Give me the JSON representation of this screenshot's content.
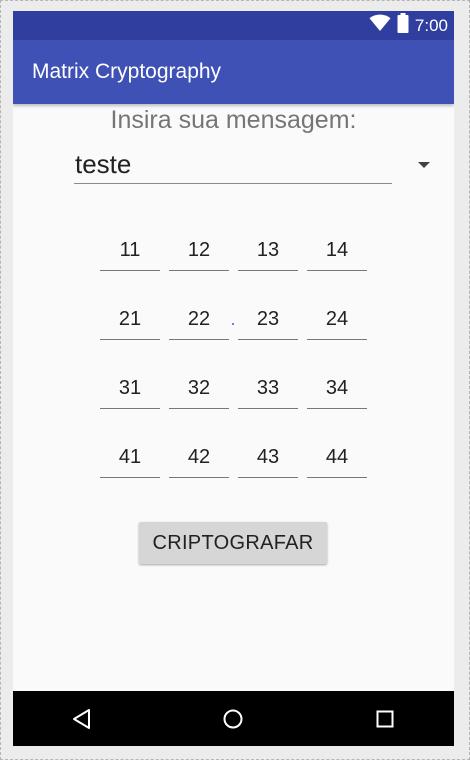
{
  "status_bar": {
    "time": "7:00",
    "icons": [
      "wifi-icon",
      "battery-icon"
    ],
    "color": "#303f9f"
  },
  "app_bar": {
    "title": "Matrix Cryptography",
    "color": "#3f51b5"
  },
  "prompt": "Insira sua mensagem:",
  "message": {
    "value": "teste",
    "dropdown_icon": "dropdown-arrow-icon"
  },
  "matrix": {
    "rows": [
      [
        "11",
        "12",
        "13",
        "14"
      ],
      [
        "21",
        "22",
        "23",
        "24"
      ],
      [
        "31",
        "32",
        "33",
        "34"
      ],
      [
        "41",
        "42",
        "43",
        "44"
      ]
    ]
  },
  "encrypt_button": {
    "label": "CRIPTOGRAFAR"
  },
  "nav_bar": {
    "icons": [
      "back-icon",
      "home-icon",
      "recents-icon"
    ]
  }
}
